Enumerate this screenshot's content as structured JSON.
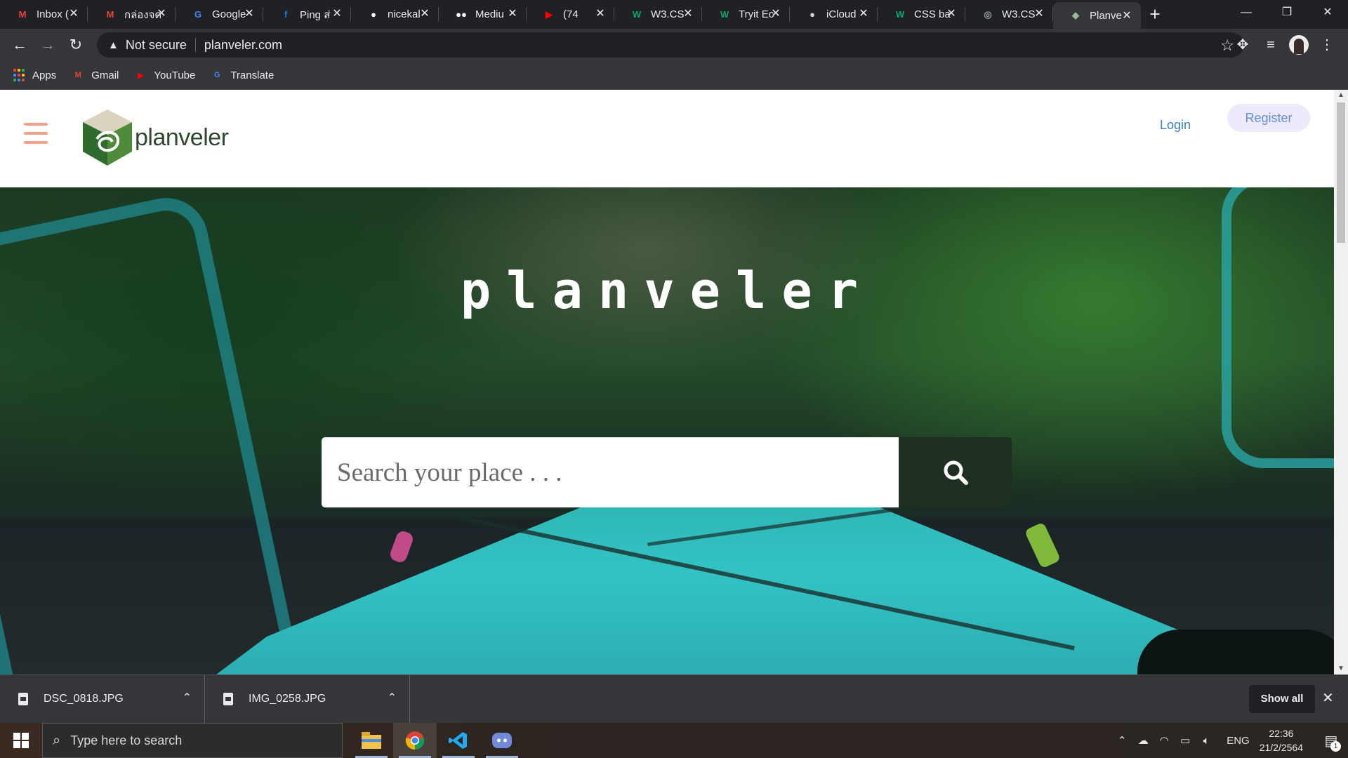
{
  "browser": {
    "tabs": [
      {
        "title": "Inbox (",
        "icon": "gmail-icon",
        "color": "#ea4335",
        "glyph": "M"
      },
      {
        "title": "กล่องจด",
        "icon": "gmail-icon",
        "color": "#ea4335",
        "glyph": "M"
      },
      {
        "title": "Google",
        "icon": "google-translate-icon",
        "color": "#4285f4",
        "glyph": "G"
      },
      {
        "title": "Ping ส่",
        "icon": "facebook-icon",
        "color": "#1877f2",
        "glyph": "f"
      },
      {
        "title": "nicekal",
        "icon": "github-icon",
        "color": "#ffffff",
        "glyph": "●"
      },
      {
        "title": "Mediu",
        "icon": "medium-icon",
        "color": "#ffffff",
        "glyph": "●●"
      },
      {
        "title": "(74",
        "icon": "youtube-icon",
        "color": "#ff0000",
        "glyph": "▶"
      },
      {
        "title": "W3.CS",
        "icon": "w3schools-icon",
        "color": "#04aa6d",
        "glyph": "W"
      },
      {
        "title": "Tryit Ec",
        "icon": "w3schools-icon",
        "color": "#04aa6d",
        "glyph": "W"
      },
      {
        "title": "iCloud",
        "icon": "apple-icon",
        "color": "#cfcfcf",
        "glyph": "●"
      },
      {
        "title": "CSS ba",
        "icon": "w3schools-icon",
        "color": "#04aa6d",
        "glyph": "W"
      },
      {
        "title": "W3.CS",
        "icon": "globe-icon",
        "color": "#9aa0a6",
        "glyph": "◎"
      },
      {
        "title": "Planve",
        "icon": "planveler-icon",
        "color": "#9bb59b",
        "glyph": "◆",
        "active": true
      }
    ],
    "omnibox": {
      "security": "Not secure",
      "url": "planveler.com"
    },
    "bookmarks": [
      {
        "label": "Apps",
        "icon": "apps-grid-icon"
      },
      {
        "label": "Gmail",
        "icon": "gmail-icon",
        "color": "#ea4335",
        "glyph": "M"
      },
      {
        "label": "YouTube",
        "icon": "youtube-icon",
        "color": "#ff0000",
        "glyph": "▶"
      },
      {
        "label": "Translate",
        "icon": "google-translate-icon",
        "color": "#4285f4",
        "glyph": "G"
      }
    ]
  },
  "site": {
    "brand": "planveler",
    "nav": {
      "login": "Login",
      "register": "Register"
    },
    "hero": {
      "title": "planveler",
      "search_placeholder": "Search your place . . ."
    },
    "colors": {
      "accent_dark_green": "#1f2e21",
      "hamburger": "#f4a08a",
      "link_blue": "#3b7fd4"
    }
  },
  "downloads": {
    "items": [
      {
        "name": "DSC_0818.JPG"
      },
      {
        "name": "IMG_0258.JPG"
      }
    ],
    "show_all": "Show all"
  },
  "taskbar": {
    "search_placeholder": "Type here to search",
    "lang": "ENG",
    "time": "22:36",
    "date": "21/2/2564",
    "notifications": "1"
  }
}
